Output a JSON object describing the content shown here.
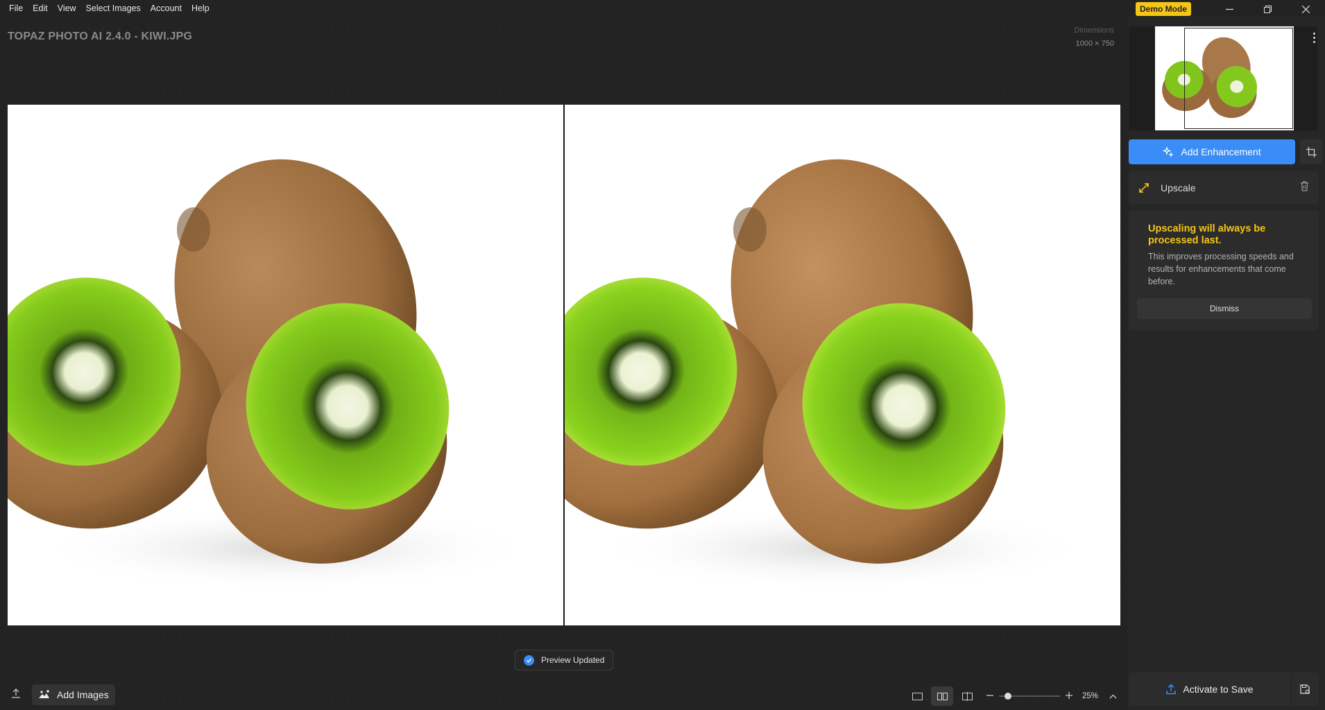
{
  "menu": [
    "File",
    "Edit",
    "View",
    "Select Images",
    "Account",
    "Help"
  ],
  "window": {
    "demo_badge": "Demo Mode"
  },
  "header": {
    "title": "TOPAZ PHOTO AI 2.4.0 - KIWI.JPG",
    "dimensions_label": "Dimensions",
    "dimensions_value": "1000 × 750"
  },
  "toast": {
    "text": "Preview Updated"
  },
  "bottom": {
    "add_images_label": "Add Images",
    "zoom_value": "25%",
    "zoom_level": 0.1,
    "active_view": "side-by-side"
  },
  "panel": {
    "add_enhancement_label": "Add Enhancement",
    "enhancements": [
      {
        "label": "Upscale",
        "icon": "upscale-arrows-icon",
        "icon_color": "#f5c518"
      }
    ],
    "notice_title": "Upscaling will always be processed last.",
    "notice_body": "This improves processing speeds and results for enhancements that come before.",
    "dismiss_label": "Dismiss",
    "activate_label": "Activate to Save"
  },
  "colors": {
    "accent": "#3a8df7",
    "warning": "#f5c518",
    "background": "#232323"
  }
}
